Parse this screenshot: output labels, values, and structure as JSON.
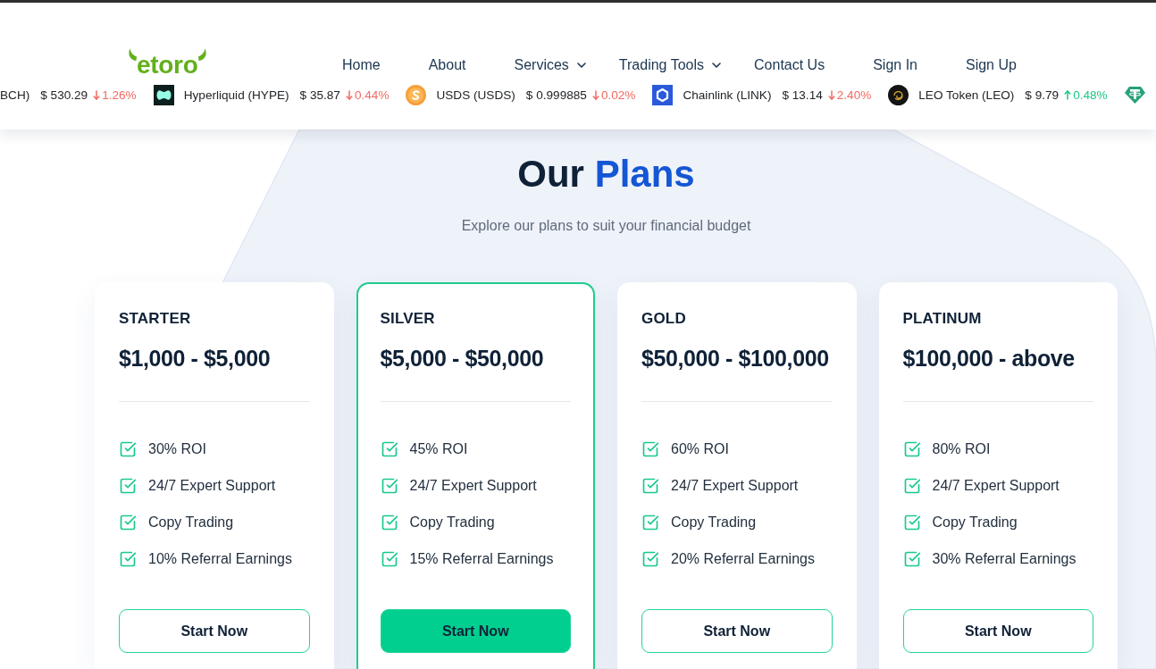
{
  "header": {
    "logo": "etoro",
    "nav": [
      {
        "label": "Home",
        "dropdown": false
      },
      {
        "label": "About",
        "dropdown": false
      },
      {
        "label": "Services",
        "dropdown": true
      },
      {
        "label": "Trading Tools",
        "dropdown": true
      },
      {
        "label": "Contact Us",
        "dropdown": false
      },
      {
        "label": "Sign In",
        "dropdown": false
      },
      {
        "label": "Sign Up",
        "dropdown": false
      }
    ]
  },
  "ticker": [
    {
      "name": "BCH)",
      "price": "$ 530.29",
      "change": "1.26%",
      "rising": false
    },
    {
      "name": "Hyperliquid (HYPE)",
      "price": "$ 35.87",
      "change": "0.44%",
      "rising": false
    },
    {
      "name": "USDS (USDS)",
      "price": "$ 0.999885",
      "change": "0.02%",
      "rising": false
    },
    {
      "name": "Chainlink (LINK)",
      "price": "$ 13.14",
      "change": "2.40%",
      "rising": false
    },
    {
      "name": "LEO Token (LEO)",
      "price": "$ 9.79",
      "change": "0.48%",
      "rising": true
    }
  ],
  "plans_section": {
    "title": "Our",
    "title_highlight": "Plans",
    "subtitle": "Explore our plans to suit your financial budget",
    "plans": [
      {
        "name": "STARTER",
        "price": "$1,000 - $5,000",
        "features": [
          "30% ROI",
          "24/7 Expert Support",
          "Copy Trading",
          "10% Referral Earnings"
        ],
        "button": "Start Now",
        "highlighted": false
      },
      {
        "name": "SILVER",
        "price": "$5,000 - $50,000",
        "features": [
          "45% ROI",
          "24/7 Expert Support",
          "Copy Trading",
          "15% Referral Earnings"
        ],
        "button": "Start Now",
        "highlighted": true
      },
      {
        "name": "GOLD",
        "price": "$50,000 - $100,000",
        "features": [
          "60% ROI",
          "24/7 Expert Support",
          "Copy Trading",
          "20% Referral Earnings"
        ],
        "button": "Start Now",
        "highlighted": false
      },
      {
        "name": "PLATINUM",
        "price": "$100,000 - above",
        "features": [
          "80% ROI",
          "24/7 Expert Support",
          "Copy Trading",
          "30% Referral Earnings"
        ],
        "button": "Start Now",
        "highlighted": false
      }
    ]
  }
}
